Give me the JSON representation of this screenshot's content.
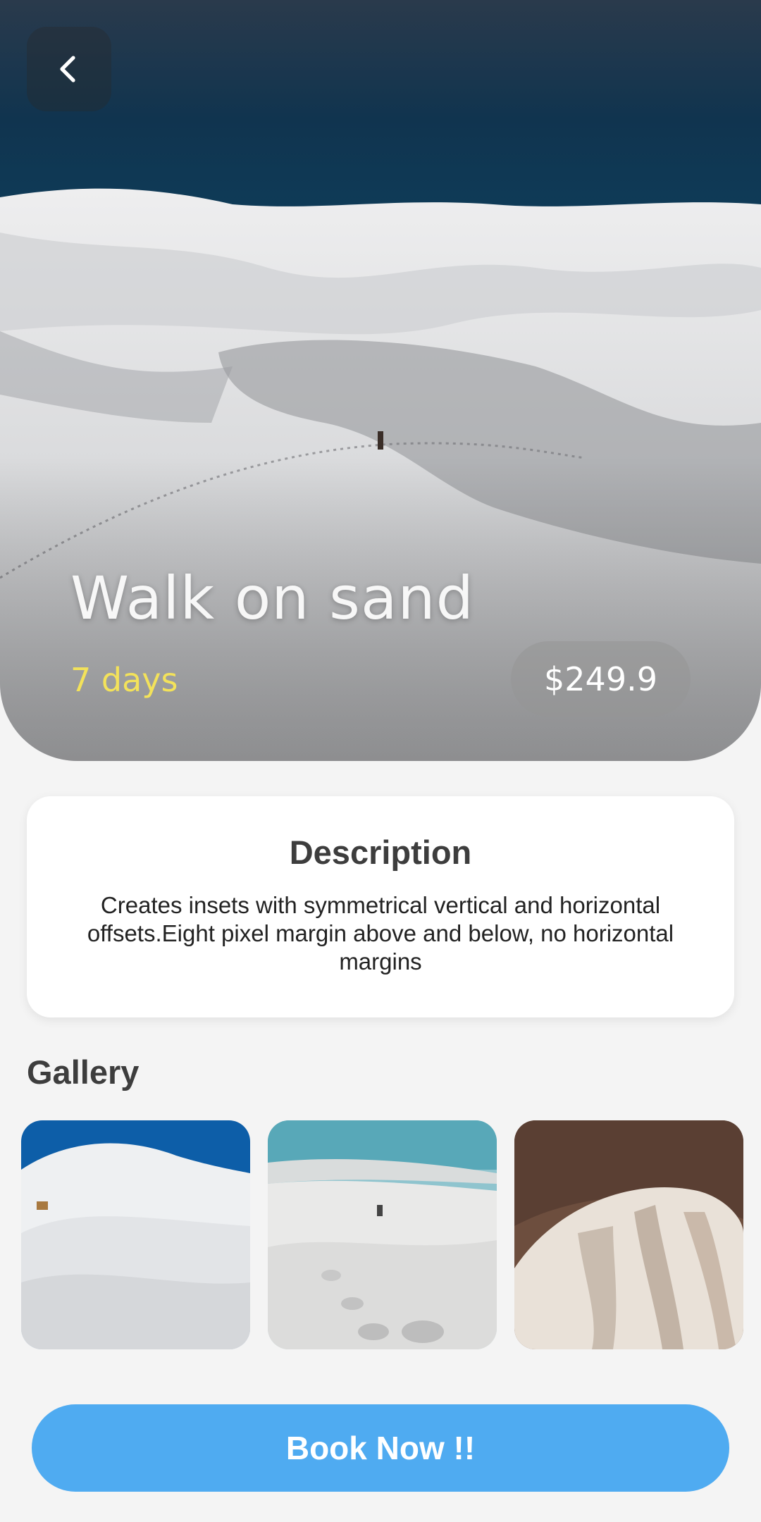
{
  "hero": {
    "title": "Walk on sand",
    "duration": "7 days",
    "price": "$249.9",
    "back_icon": "chevron-left-icon"
  },
  "description": {
    "title": "Description",
    "text": "Creates insets with symmetrical vertical and horizontal offsets.Eight pixel margin above and below, no horizontal margins"
  },
  "gallery": {
    "title": "Gallery",
    "images": [
      {
        "name": "gallery-image-dunes-camel"
      },
      {
        "name": "gallery-image-footprints-beach"
      },
      {
        "name": "gallery-image-dune-ridges"
      }
    ]
  },
  "book": {
    "label": "Book Now !!"
  },
  "colors": {
    "accent": "#4fabf1",
    "days": "#f3e25a",
    "background": "#f4f4f4"
  }
}
